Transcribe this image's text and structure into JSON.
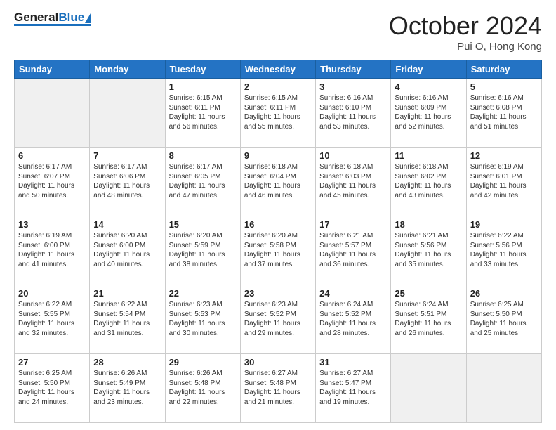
{
  "header": {
    "month_title": "October 2024",
    "location": "Pui O, Hong Kong",
    "logo_general": "General",
    "logo_blue": "Blue"
  },
  "weekdays": [
    "Sunday",
    "Monday",
    "Tuesday",
    "Wednesday",
    "Thursday",
    "Friday",
    "Saturday"
  ],
  "weeks": [
    [
      {
        "day": "",
        "sunrise": "",
        "sunset": "",
        "daylight": ""
      },
      {
        "day": "",
        "sunrise": "",
        "sunset": "",
        "daylight": ""
      },
      {
        "day": "1",
        "sunrise": "Sunrise: 6:15 AM",
        "sunset": "Sunset: 6:11 PM",
        "daylight": "Daylight: 11 hours and 56 minutes."
      },
      {
        "day": "2",
        "sunrise": "Sunrise: 6:15 AM",
        "sunset": "Sunset: 6:11 PM",
        "daylight": "Daylight: 11 hours and 55 minutes."
      },
      {
        "day": "3",
        "sunrise": "Sunrise: 6:16 AM",
        "sunset": "Sunset: 6:10 PM",
        "daylight": "Daylight: 11 hours and 53 minutes."
      },
      {
        "day": "4",
        "sunrise": "Sunrise: 6:16 AM",
        "sunset": "Sunset: 6:09 PM",
        "daylight": "Daylight: 11 hours and 52 minutes."
      },
      {
        "day": "5",
        "sunrise": "Sunrise: 6:16 AM",
        "sunset": "Sunset: 6:08 PM",
        "daylight": "Daylight: 11 hours and 51 minutes."
      }
    ],
    [
      {
        "day": "6",
        "sunrise": "Sunrise: 6:17 AM",
        "sunset": "Sunset: 6:07 PM",
        "daylight": "Daylight: 11 hours and 50 minutes."
      },
      {
        "day": "7",
        "sunrise": "Sunrise: 6:17 AM",
        "sunset": "Sunset: 6:06 PM",
        "daylight": "Daylight: 11 hours and 48 minutes."
      },
      {
        "day": "8",
        "sunrise": "Sunrise: 6:17 AM",
        "sunset": "Sunset: 6:05 PM",
        "daylight": "Daylight: 11 hours and 47 minutes."
      },
      {
        "day": "9",
        "sunrise": "Sunrise: 6:18 AM",
        "sunset": "Sunset: 6:04 PM",
        "daylight": "Daylight: 11 hours and 46 minutes."
      },
      {
        "day": "10",
        "sunrise": "Sunrise: 6:18 AM",
        "sunset": "Sunset: 6:03 PM",
        "daylight": "Daylight: 11 hours and 45 minutes."
      },
      {
        "day": "11",
        "sunrise": "Sunrise: 6:18 AM",
        "sunset": "Sunset: 6:02 PM",
        "daylight": "Daylight: 11 hours and 43 minutes."
      },
      {
        "day": "12",
        "sunrise": "Sunrise: 6:19 AM",
        "sunset": "Sunset: 6:01 PM",
        "daylight": "Daylight: 11 hours and 42 minutes."
      }
    ],
    [
      {
        "day": "13",
        "sunrise": "Sunrise: 6:19 AM",
        "sunset": "Sunset: 6:00 PM",
        "daylight": "Daylight: 11 hours and 41 minutes."
      },
      {
        "day": "14",
        "sunrise": "Sunrise: 6:20 AM",
        "sunset": "Sunset: 6:00 PM",
        "daylight": "Daylight: 11 hours and 40 minutes."
      },
      {
        "day": "15",
        "sunrise": "Sunrise: 6:20 AM",
        "sunset": "Sunset: 5:59 PM",
        "daylight": "Daylight: 11 hours and 38 minutes."
      },
      {
        "day": "16",
        "sunrise": "Sunrise: 6:20 AM",
        "sunset": "Sunset: 5:58 PM",
        "daylight": "Daylight: 11 hours and 37 minutes."
      },
      {
        "day": "17",
        "sunrise": "Sunrise: 6:21 AM",
        "sunset": "Sunset: 5:57 PM",
        "daylight": "Daylight: 11 hours and 36 minutes."
      },
      {
        "day": "18",
        "sunrise": "Sunrise: 6:21 AM",
        "sunset": "Sunset: 5:56 PM",
        "daylight": "Daylight: 11 hours and 35 minutes."
      },
      {
        "day": "19",
        "sunrise": "Sunrise: 6:22 AM",
        "sunset": "Sunset: 5:56 PM",
        "daylight": "Daylight: 11 hours and 33 minutes."
      }
    ],
    [
      {
        "day": "20",
        "sunrise": "Sunrise: 6:22 AM",
        "sunset": "Sunset: 5:55 PM",
        "daylight": "Daylight: 11 hours and 32 minutes."
      },
      {
        "day": "21",
        "sunrise": "Sunrise: 6:22 AM",
        "sunset": "Sunset: 5:54 PM",
        "daylight": "Daylight: 11 hours and 31 minutes."
      },
      {
        "day": "22",
        "sunrise": "Sunrise: 6:23 AM",
        "sunset": "Sunset: 5:53 PM",
        "daylight": "Daylight: 11 hours and 30 minutes."
      },
      {
        "day": "23",
        "sunrise": "Sunrise: 6:23 AM",
        "sunset": "Sunset: 5:52 PM",
        "daylight": "Daylight: 11 hours and 29 minutes."
      },
      {
        "day": "24",
        "sunrise": "Sunrise: 6:24 AM",
        "sunset": "Sunset: 5:52 PM",
        "daylight": "Daylight: 11 hours and 28 minutes."
      },
      {
        "day": "25",
        "sunrise": "Sunrise: 6:24 AM",
        "sunset": "Sunset: 5:51 PM",
        "daylight": "Daylight: 11 hours and 26 minutes."
      },
      {
        "day": "26",
        "sunrise": "Sunrise: 6:25 AM",
        "sunset": "Sunset: 5:50 PM",
        "daylight": "Daylight: 11 hours and 25 minutes."
      }
    ],
    [
      {
        "day": "27",
        "sunrise": "Sunrise: 6:25 AM",
        "sunset": "Sunset: 5:50 PM",
        "daylight": "Daylight: 11 hours and 24 minutes."
      },
      {
        "day": "28",
        "sunrise": "Sunrise: 6:26 AM",
        "sunset": "Sunset: 5:49 PM",
        "daylight": "Daylight: 11 hours and 23 minutes."
      },
      {
        "day": "29",
        "sunrise": "Sunrise: 6:26 AM",
        "sunset": "Sunset: 5:48 PM",
        "daylight": "Daylight: 11 hours and 22 minutes."
      },
      {
        "day": "30",
        "sunrise": "Sunrise: 6:27 AM",
        "sunset": "Sunset: 5:48 PM",
        "daylight": "Daylight: 11 hours and 21 minutes."
      },
      {
        "day": "31",
        "sunrise": "Sunrise: 6:27 AM",
        "sunset": "Sunset: 5:47 PM",
        "daylight": "Daylight: 11 hours and 19 minutes."
      },
      {
        "day": "",
        "sunrise": "",
        "sunset": "",
        "daylight": ""
      },
      {
        "day": "",
        "sunrise": "",
        "sunset": "",
        "daylight": ""
      }
    ]
  ]
}
